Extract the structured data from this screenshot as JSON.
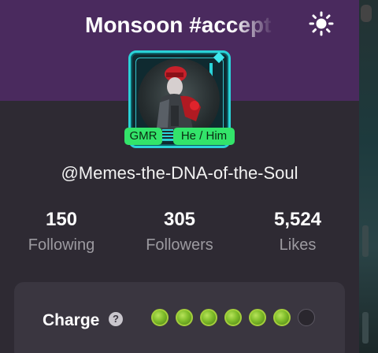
{
  "header": {
    "title": "Monsoon #accept",
    "theme_toggle_icon": "sun-icon",
    "background_color": "#4a2a5e"
  },
  "profile": {
    "avatar_icon": "avatar-photo",
    "badge_tag": "GMR",
    "pronouns": "He / Him",
    "username": "@Memes-the-DNA-of-the-Soul"
  },
  "stats": [
    {
      "value": "150",
      "label": "Following"
    },
    {
      "value": "305",
      "label": "Followers"
    },
    {
      "value": "5,524",
      "label": "Likes"
    }
  ],
  "charge": {
    "label": "Charge",
    "help_icon": "?",
    "filled": 6,
    "total": 7,
    "accent": "#7fbd2a"
  },
  "colors": {
    "panel": "#2e2a33",
    "badge": "#33e46a",
    "frame": "#2ad3d8"
  }
}
